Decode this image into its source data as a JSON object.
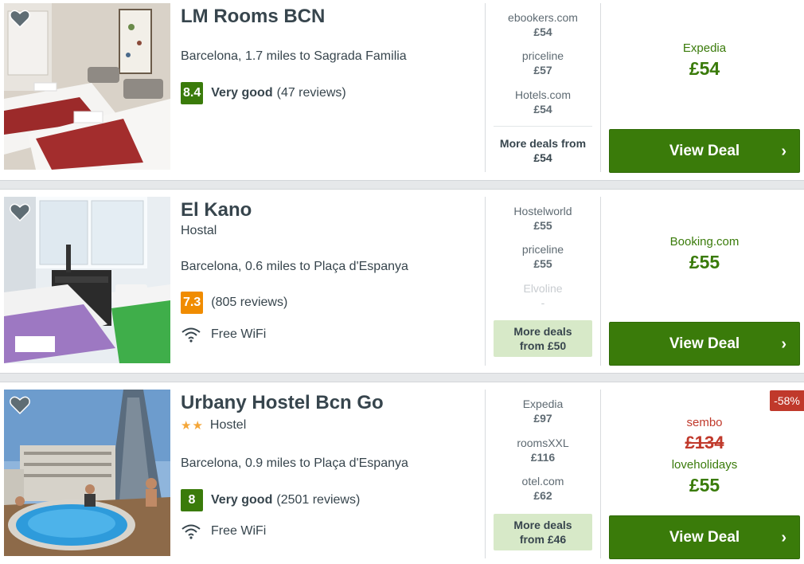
{
  "listings": [
    {
      "name": "LM Rooms BCN",
      "type": "",
      "stars": "",
      "location": "Barcelona, 1.7 miles to Sagrada Familia",
      "score": "8.4",
      "score_color": "#3a7b0a",
      "score_word": "Very good",
      "reviews": "(47 reviews)",
      "amenity": "",
      "providers": [
        {
          "name": "ebookers.com",
          "price": "£54"
        },
        {
          "name": "priceline",
          "price": "£57"
        },
        {
          "name": "Hotels.com",
          "price": "£54"
        }
      ],
      "more_deals_line1": "More deals from",
      "more_deals_line2": "£54",
      "best_provider": "Expedia",
      "best_price": "£54",
      "button": "View Deal"
    },
    {
      "name": "El Kano",
      "type": "Hostal",
      "stars": "",
      "location": "Barcelona, 0.6 miles to Plaça d'Espanya",
      "score": "7.3",
      "score_color": "#f08c00",
      "score_word": "",
      "reviews": "(805 reviews)",
      "amenity": "Free WiFi",
      "providers": [
        {
          "name": "Hostelworld",
          "price": "£55"
        },
        {
          "name": "priceline",
          "price": "£55"
        },
        {
          "name": "Elvoline",
          "price": "-"
        }
      ],
      "more_deals_line1": "More deals",
      "more_deals_line2": "from £50",
      "best_provider": "Booking.com",
      "best_price": "£55",
      "button": "View Deal"
    },
    {
      "name": "Urbany Hostel Bcn Go",
      "type": "Hostel",
      "stars": "★★",
      "location": "Barcelona, 0.9 miles to Plaça d'Espanya",
      "score": "8",
      "score_color": "#3a7b0a",
      "score_word": "Very good",
      "reviews": "(2501 reviews)",
      "amenity": "Free WiFi",
      "providers": [
        {
          "name": "Expedia",
          "price": "£97"
        },
        {
          "name": "roomsXXL",
          "price": "£116"
        },
        {
          "name": "otel.com",
          "price": "£62"
        }
      ],
      "more_deals_line1": "More deals",
      "more_deals_line2": "from £46",
      "discount": "-58%",
      "old_provider": "sembo",
      "old_price": "£134",
      "best_provider": "loveholidays",
      "best_price": "£55",
      "button": "View Deal"
    }
  ]
}
